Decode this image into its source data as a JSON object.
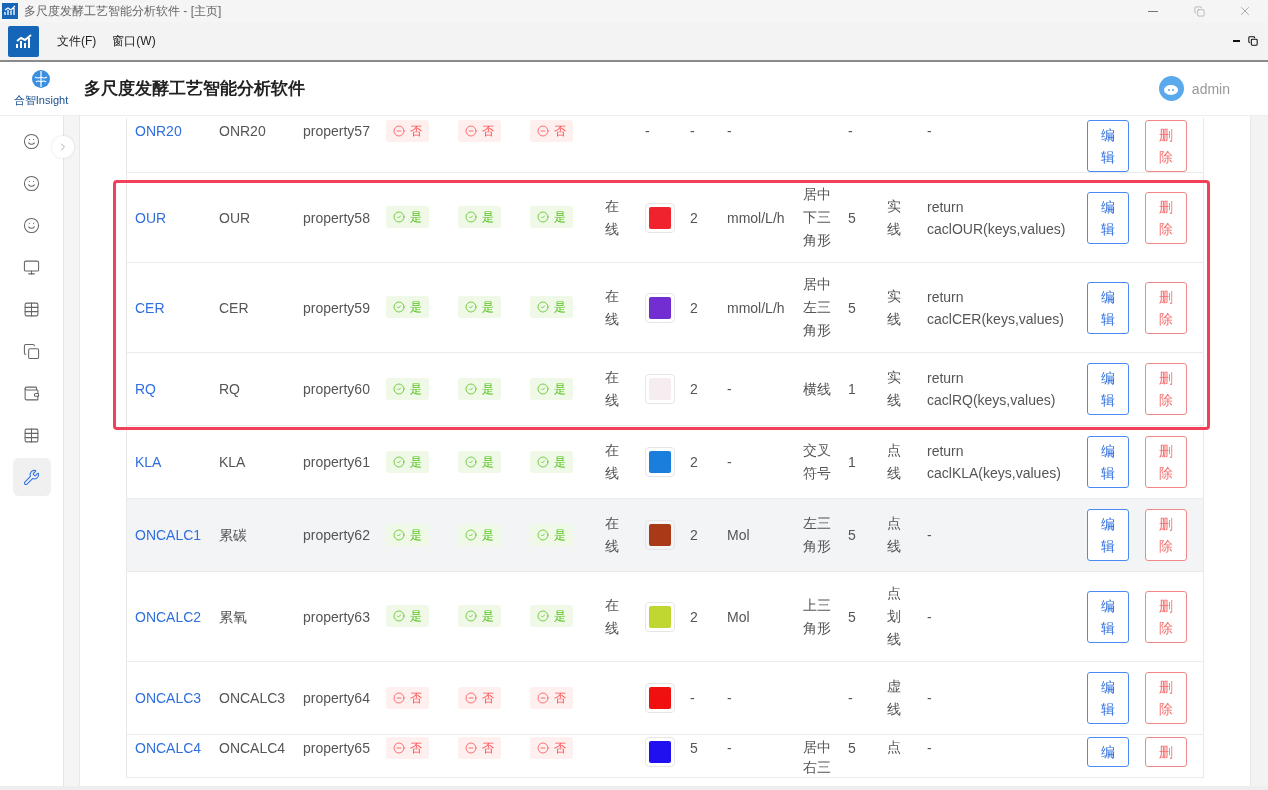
{
  "window": {
    "title": "多尺度发酵工艺智能分析软件 - [主页]"
  },
  "menu": [
    "文件(F)",
    "窗口(W)"
  ],
  "header": {
    "logo_text": "合智Insight",
    "title": "多尺度发酵工艺智能分析软件",
    "user": "admin"
  },
  "sidebar": {
    "items": [
      {
        "kind": "smile",
        "selected": false
      },
      {
        "kind": "smile",
        "selected": false
      },
      {
        "kind": "smile",
        "selected": false
      },
      {
        "kind": "monitor",
        "selected": false
      },
      {
        "kind": "table",
        "selected": false
      },
      {
        "kind": "copy",
        "selected": false
      },
      {
        "kind": "wallet",
        "selected": false
      },
      {
        "kind": "table",
        "selected": false
      },
      {
        "kind": "wrench",
        "selected": true
      }
    ]
  },
  "table": {
    "rows": [
      {
        "code": "ONR20",
        "name": "ONR20",
        "property": "property57",
        "flags": [
          {
            "label": "否",
            "on": false
          },
          {
            "label": "否",
            "on": false
          },
          {
            "label": "否",
            "on": false
          }
        ],
        "status": "",
        "color": null,
        "color_text": "-",
        "number": "-",
        "unit": "-",
        "shape": "",
        "size": "-",
        "line_type": "",
        "formula": "-",
        "edit": "编辑",
        "delete": "删除",
        "highlighted": false,
        "hovered": false
      },
      {
        "code": "OUR",
        "name": "OUR",
        "property": "property58",
        "flags": [
          {
            "label": "是",
            "on": true
          },
          {
            "label": "是",
            "on": true
          },
          {
            "label": "是",
            "on": true
          }
        ],
        "status": "在线",
        "color": "#f0222e",
        "number": "2",
        "unit": "mmol/L/h",
        "shape": "居中下三角形",
        "size": "5",
        "line_type": "实线",
        "formula": "return caclOUR(keys,values)",
        "edit": "编辑",
        "delete": "删除",
        "highlighted": true,
        "hovered": false
      },
      {
        "code": "CER",
        "name": "CER",
        "property": "property59",
        "flags": [
          {
            "label": "是",
            "on": true
          },
          {
            "label": "是",
            "on": true
          },
          {
            "label": "是",
            "on": true
          }
        ],
        "status": "在线",
        "color": "#722ed1",
        "number": "2",
        "unit": "mmol/L/h",
        "shape": "居中左三角形",
        "size": "5",
        "line_type": "实线",
        "formula": "return caclCER(keys,values)",
        "edit": "编辑",
        "delete": "删除",
        "highlighted": true,
        "hovered": false
      },
      {
        "code": "RQ",
        "name": "RQ",
        "property": "property60",
        "flags": [
          {
            "label": "是",
            "on": true
          },
          {
            "label": "是",
            "on": true
          },
          {
            "label": "是",
            "on": true
          }
        ],
        "status": "在线",
        "color": "#f5edf0",
        "number": "2",
        "unit": "-",
        "shape": "横线",
        "size": "1",
        "line_type": "实线",
        "formula": "return caclRQ(keys,values)",
        "edit": "编辑",
        "delete": "删除",
        "highlighted": true,
        "hovered": false
      },
      {
        "code": "KLA",
        "name": "KLA",
        "property": "property61",
        "flags": [
          {
            "label": "是",
            "on": true
          },
          {
            "label": "是",
            "on": true
          },
          {
            "label": "是",
            "on": true
          }
        ],
        "status": "在线",
        "color": "#1a7fdc",
        "number": "2",
        "unit": "-",
        "shape": "交叉符号",
        "size": "1",
        "line_type": "点线",
        "formula": "return caclKLA(keys,values)",
        "edit": "编辑",
        "delete": "删除",
        "highlighted": false,
        "hovered": false
      },
      {
        "code": "ONCALC1",
        "name": "累碳",
        "property": "property62",
        "flags": [
          {
            "label": "是",
            "on": true
          },
          {
            "label": "是",
            "on": true
          },
          {
            "label": "是",
            "on": true
          }
        ],
        "status": "在线",
        "color": "#a83a18",
        "number": "2",
        "unit": "Mol",
        "shape": "左三角形",
        "size": "5",
        "line_type": "点线",
        "formula": "-",
        "edit": "编辑",
        "delete": "删除",
        "highlighted": false,
        "hovered": true
      },
      {
        "code": "ONCALC2",
        "name": "累氧",
        "property": "property63",
        "flags": [
          {
            "label": "是",
            "on": true
          },
          {
            "label": "是",
            "on": true
          },
          {
            "label": "是",
            "on": true
          }
        ],
        "status": "在线",
        "color": "#c0d631",
        "number": "2",
        "unit": "Mol",
        "shape": "上三角形",
        "size": "5",
        "line_type": "点划线",
        "formula": "-",
        "edit": "编辑",
        "delete": "删除",
        "highlighted": false,
        "hovered": false
      },
      {
        "code": "ONCALC3",
        "name": "ONCALC3",
        "property": "property64",
        "flags": [
          {
            "label": "否",
            "on": false
          },
          {
            "label": "否",
            "on": false
          },
          {
            "label": "否",
            "on": false
          }
        ],
        "status": "",
        "color": "#f01010",
        "number": "-",
        "unit": "-",
        "shape": "",
        "size": "-",
        "line_type": "虚线",
        "formula": "-",
        "edit": "编辑",
        "delete": "删除",
        "highlighted": false,
        "hovered": false
      },
      {
        "code": "ONCALC4",
        "name": "ONCALC4",
        "property": "property65",
        "flags": [
          {
            "label": "否",
            "on": false
          },
          {
            "label": "否",
            "on": false
          },
          {
            "label": "否",
            "on": false
          }
        ],
        "status": "",
        "color": "#2010f0",
        "number": "5",
        "unit": "-",
        "shape": "居中右三",
        "size": "5",
        "line_type": "点",
        "formula": "-",
        "edit": "编",
        "delete": "删",
        "highlighted": false,
        "hovered": false
      }
    ]
  }
}
